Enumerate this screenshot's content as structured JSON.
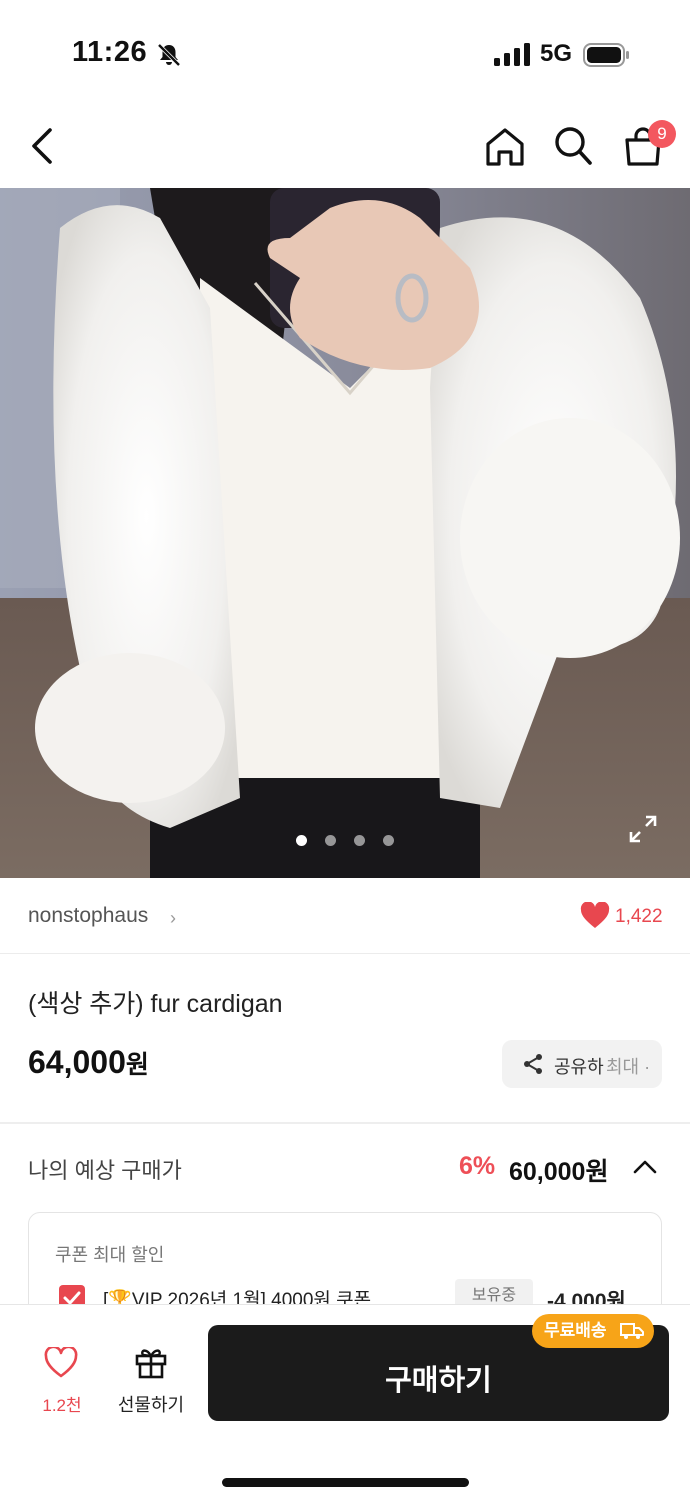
{
  "status_bar": {
    "time": "11:26",
    "network": "5G",
    "icons": [
      "bell-off-icon",
      "signal-icon",
      "battery-icon"
    ]
  },
  "nav": {
    "icons": [
      "back-icon",
      "home-icon",
      "search-icon",
      "cart-icon"
    ],
    "cart_badge": "9"
  },
  "gallery": {
    "image_count": 4,
    "active_index": 0,
    "icon": "expand-icon"
  },
  "shop": {
    "name": "nonstophaus",
    "chevron": "›",
    "like_count": "1,422"
  },
  "product": {
    "title": "(색상 추가) fur cardigan",
    "price": "64,000",
    "price_unit": "원"
  },
  "share": {
    "label": "공유하",
    "extra": "최대 ·"
  },
  "estimate": {
    "label": "나의 예상 구매가",
    "discount": "6%",
    "price": "60,000원"
  },
  "coupon": {
    "title": "쿠폰 최대 할인",
    "name": "[🏆VIP 2026년 1월] 4000원 쿠폰",
    "tag": "보유중",
    "amount": "-4,000원",
    "checked": true
  },
  "bottom": {
    "wish_count": "1.2천",
    "gift_label": "선물하기",
    "buy_label": "구매하기",
    "shipping_badge": "무료배송"
  },
  "colors": {
    "accent_red": "#e8474f",
    "badge_orange": "#f7a418",
    "buy_button": "#1b1b1b"
  }
}
